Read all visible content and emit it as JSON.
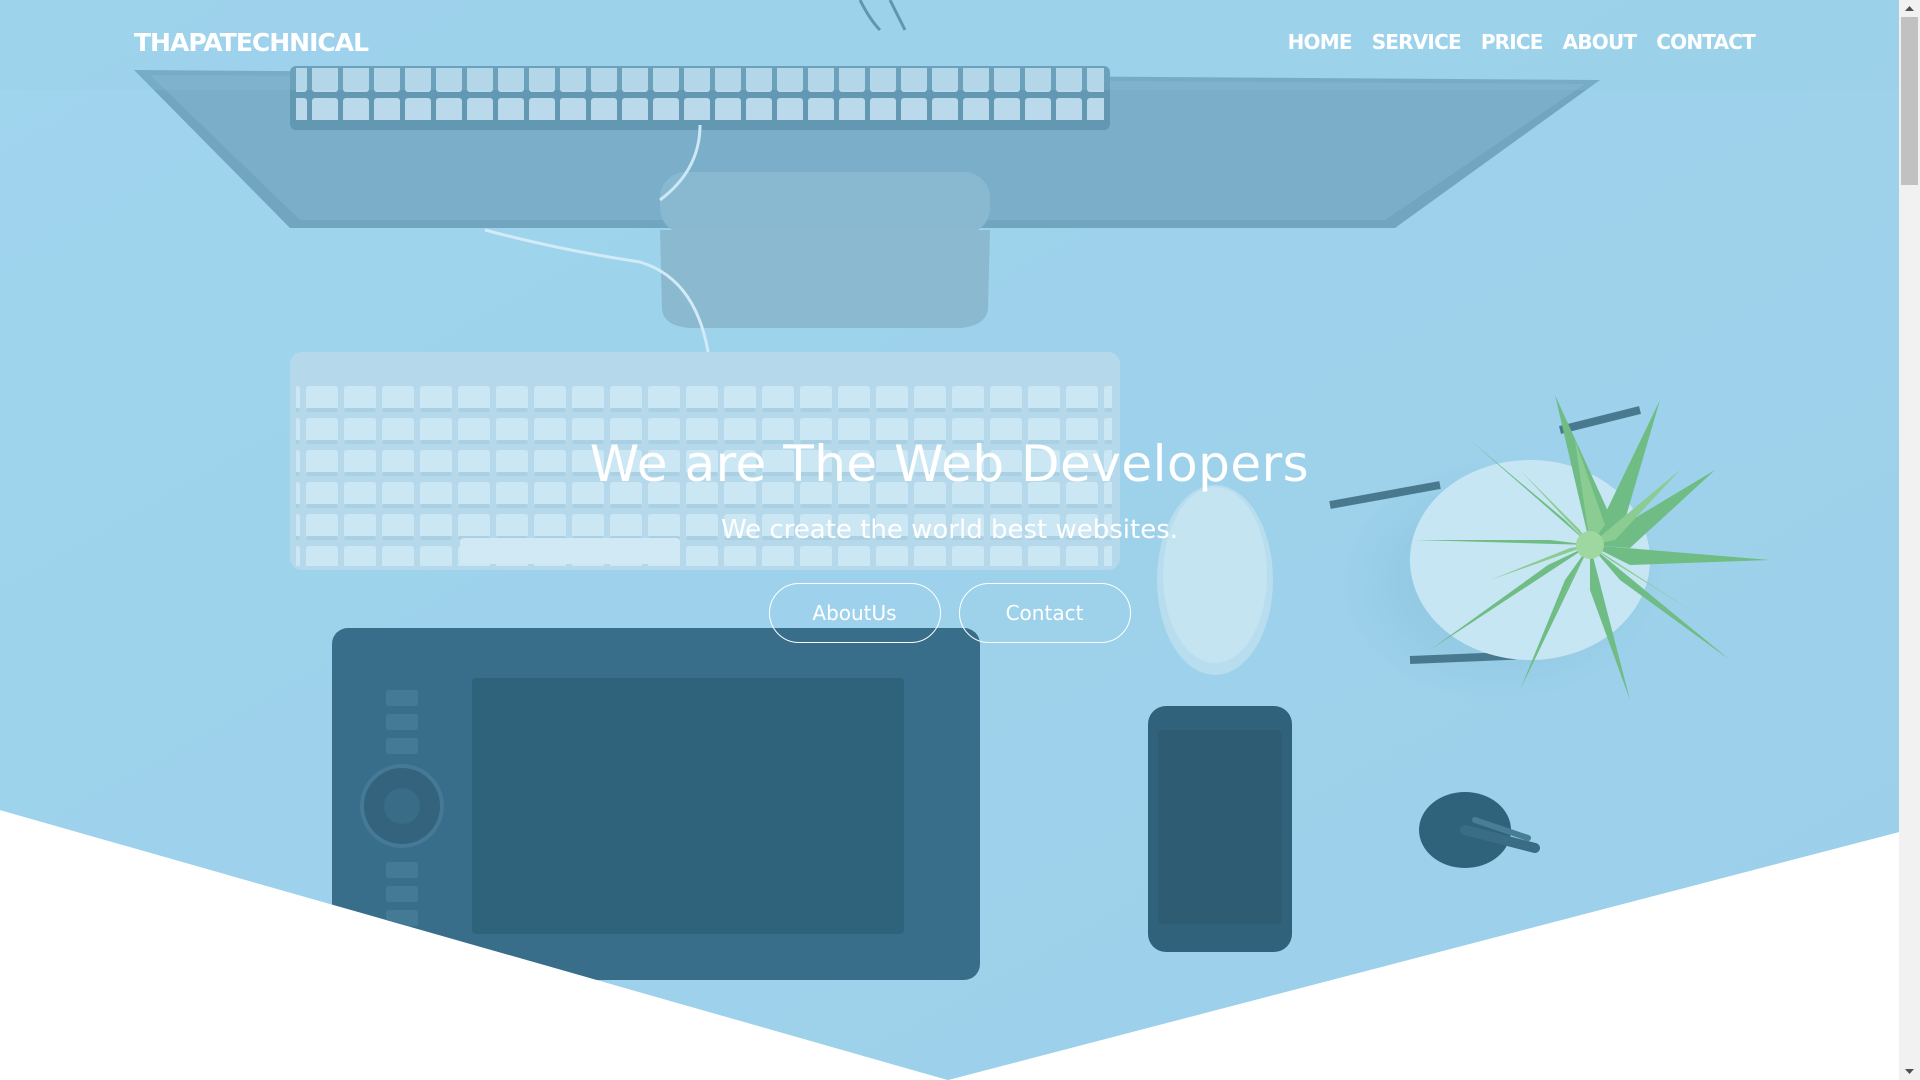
{
  "brand": {
    "logo": "THAPATECHNICAL"
  },
  "nav": {
    "items": [
      {
        "label": "HOME"
      },
      {
        "label": "SERVICE"
      },
      {
        "label": "PRICE"
      },
      {
        "label": "ABOUT"
      },
      {
        "label": "CONTACT"
      }
    ]
  },
  "hero": {
    "title": "We are The Web Developers",
    "subtitle": "We create the world best websites.",
    "buttons": {
      "about": "AboutUs",
      "contact": "Contact"
    },
    "overlay_color": "#87c6e8",
    "background_description_icons": [
      "monitor-stand",
      "keyboard",
      "mouse",
      "drawing-tablet",
      "smartphone",
      "potted-succulent",
      "pen-holder"
    ]
  },
  "colors": {
    "nav_text": "#ffffff",
    "hero_text": "#ffffff",
    "page_background": "#ffffff",
    "scrollbar_track": "#f1f1f1",
    "scrollbar_thumb": "#c1c1c1"
  }
}
